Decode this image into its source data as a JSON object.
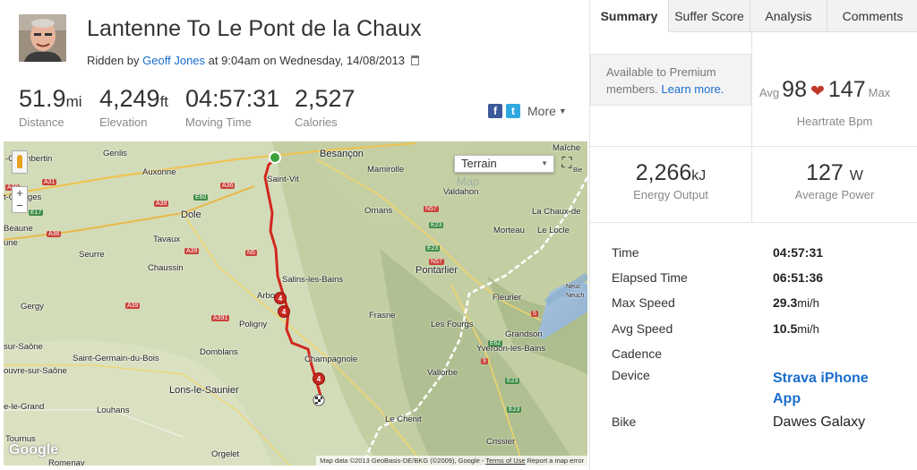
{
  "activity": {
    "title": "Lantenne To Le Pont de la Chaux",
    "ridden_by_prefix": "Ridden by",
    "athlete": "Geoff Jones",
    "at_prefix": "at",
    "time": "9:04am",
    "on_prefix": "on",
    "date": "Wednesday, 14/08/2013"
  },
  "stats": [
    {
      "value": "51.9",
      "unit": "mi",
      "label": "Distance"
    },
    {
      "value": "4,249",
      "unit": "ft",
      "label": "Elevation"
    },
    {
      "value": "04:57:31",
      "unit": "",
      "label": "Moving Time"
    },
    {
      "value": "2,527",
      "unit": "",
      "label": "Calories"
    }
  ],
  "share": {
    "facebook_icon": "f",
    "twitter_icon": "t",
    "more_label": "More",
    "more_icon": "chevron-down-icon"
  },
  "map": {
    "layer_select": "Terrain",
    "watermark": "Map",
    "logo": "Google",
    "attribution": "Map data ©2013 GeoBasis-DE/BKG (©2009), Google -",
    "terms": "Terms of Use",
    "report": "Report a map error",
    "zoom_in": "+",
    "zoom_out": "−",
    "labels": [
      "Maîche",
      "-Chambertin",
      "Genlis",
      "Auxonne",
      "Besançon",
      "Mamirolle",
      "Saint-Vit",
      "Valdahon",
      "t-Georges",
      "Dole",
      "Ornans",
      "La Chaux-de",
      "Beaune",
      "Tavaux",
      "Morteau",
      "Le Locle",
      "une",
      "Seurre",
      "Chaussin",
      "Salins-les-Bains",
      "Pontarlier",
      "Fleurier",
      "Gergy",
      "Arbois",
      "Frasne",
      "Les Fourgs",
      "Poligny",
      "sur-Saône",
      "Grandson",
      "Domblans",
      "Champagnole",
      "Yverdon-les-Bains",
      "ouvre-sur-Saône",
      "Saint-Germain-du-Bois",
      "Vallorbe",
      "Lons-le-Saunier",
      "Louhans",
      "e-le-Grand",
      "Le Chenit",
      "Tournus",
      "Crissier",
      "Orgelet",
      "Romenay",
      "Neuc",
      "Neuch",
      "Bie"
    ],
    "road_badges": [
      "A31",
      "A39",
      "E60",
      "A36",
      "A39",
      "E17",
      "A36",
      "A39",
      "A39",
      "N57",
      "E23",
      "E23",
      "N57",
      "A391",
      "N5",
      "E23",
      "E62",
      "E23",
      "5",
      "9"
    ],
    "markers": [
      "4",
      "4",
      "4"
    ]
  },
  "tabs": [
    "Summary",
    "Suffer Score",
    "Analysis",
    "Comments"
  ],
  "summary": {
    "premium_text": "Available to Premium members.",
    "premium_link": "Learn more.",
    "heartrate": {
      "avg_label": "Avg",
      "avg": "98",
      "max": "147",
      "max_label": "Max",
      "label": "Heartrate",
      "unit": "Bpm"
    },
    "energy": {
      "value": "2,266",
      "unit": "kJ",
      "label": "Energy Output"
    },
    "power": {
      "value": "127",
      "unit": "W",
      "label": "Average Power"
    },
    "details": [
      {
        "key": "Time",
        "value": "04:57:31",
        "unit": ""
      },
      {
        "key": "Elapsed Time",
        "value": "06:51:36",
        "unit": ""
      },
      {
        "key": "Max Speed",
        "value": "29.3",
        "unit": "mi/h"
      },
      {
        "key": "Avg Speed",
        "value": "10.5",
        "unit": "mi/h"
      },
      {
        "key": "Cadence",
        "value": "",
        "unit": ""
      },
      {
        "key": "Device",
        "value": "Strava iPhone App",
        "unit": ""
      },
      {
        "key": "Bike",
        "value": "Dawes Galaxy",
        "unit": ""
      }
    ]
  }
}
